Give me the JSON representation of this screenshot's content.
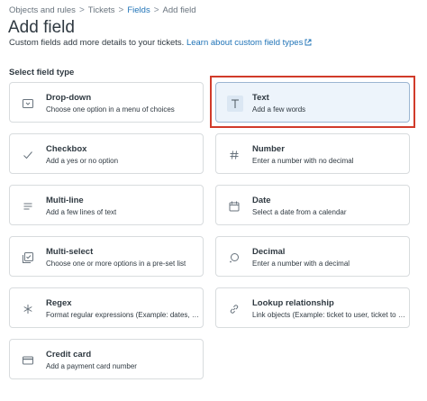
{
  "breadcrumb": {
    "items": [
      "Objects and rules",
      "Tickets",
      "Fields",
      "Add field"
    ],
    "separator": ">"
  },
  "header": {
    "title": "Add field",
    "subtitle": "Custom fields add more details to your tickets.",
    "learn_link": "Learn about custom field types"
  },
  "section": {
    "label": "Select field type"
  },
  "fields": [
    {
      "title": "Drop-down",
      "desc": "Choose one option in a menu of choices",
      "icon": "dropdown-icon"
    },
    {
      "title": "Text",
      "desc": "Add a few words",
      "icon": "text-icon",
      "selected": true
    },
    {
      "title": "Checkbox",
      "desc": "Add a yes or no option",
      "icon": "checkmark-icon"
    },
    {
      "title": "Number",
      "desc": "Enter a number with no decimal",
      "icon": "hash-icon"
    },
    {
      "title": "Multi-line",
      "desc": "Add a few lines of text",
      "icon": "lines-icon"
    },
    {
      "title": "Date",
      "desc": "Select a date from a calendar",
      "icon": "calendar-icon"
    },
    {
      "title": "Multi-select",
      "desc": "Choose one or more options in a pre-set list",
      "icon": "multiselect-icon"
    },
    {
      "title": "Decimal",
      "desc": "Enter a number with a decimal",
      "icon": "decimal-icon"
    },
    {
      "title": "Regex",
      "desc": "Format regular expressions (Example: dates, URLs)",
      "icon": "asterisk-icon"
    },
    {
      "title": "Lookup relationship",
      "desc": "Link objects (Example: ticket to user, ticket to ticket)",
      "icon": "link-icon"
    },
    {
      "title": "Credit card",
      "desc": "Add a payment card number",
      "icon": "credit-card-icon"
    }
  ],
  "colors": {
    "link": "#1f73b7",
    "text": "#2f3941",
    "border": "#d8dcde",
    "selected_bg": "#edf4fb",
    "highlight": "#d13b2a"
  }
}
